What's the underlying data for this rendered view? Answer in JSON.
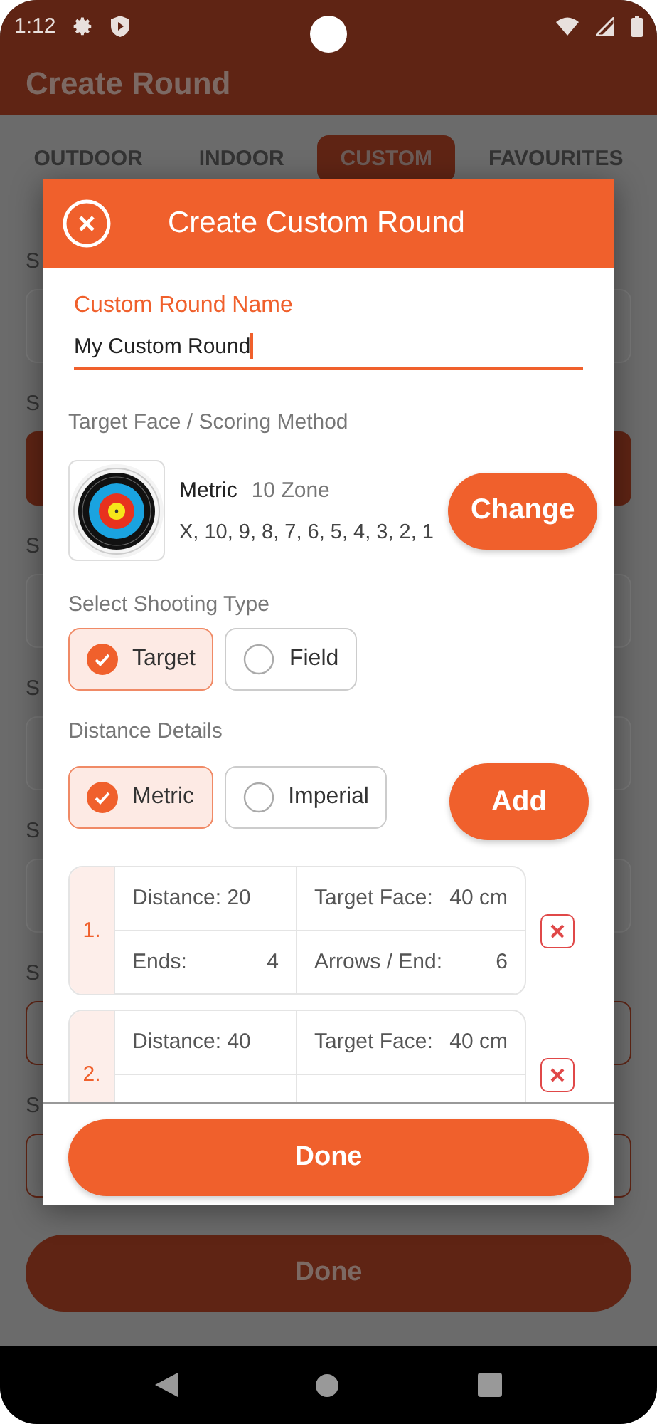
{
  "status_bar": {
    "time": "1:12"
  },
  "app_bar": {
    "title": "Create Round"
  },
  "tabs": [
    {
      "label": "OUTDOOR",
      "selected": false
    },
    {
      "label": "INDOOR",
      "selected": false
    },
    {
      "label": "CUSTOM",
      "selected": true
    },
    {
      "label": "FAVOURITES",
      "selected": false
    }
  ],
  "background_form": [
    {
      "kind": "field",
      "label": "S"
    },
    {
      "kind": "filled",
      "label": "S"
    },
    {
      "kind": "field",
      "label": "S"
    },
    {
      "kind": "field",
      "label": "S"
    },
    {
      "kind": "field",
      "label": "S"
    },
    {
      "kind": "outlined",
      "label": "S"
    },
    {
      "kind": "outlined",
      "label": "S"
    }
  ],
  "background_done": "Done",
  "dialog": {
    "title": "Create Custom Round",
    "name_field": {
      "label": "Custom Round Name",
      "value": "My Custom Round"
    },
    "target_face": {
      "label": "Target Face / Scoring Method",
      "name": "Metric",
      "zones": "10 Zone",
      "scores": "X, 10, 9, 8, 7, 6, 5, 4, 3, 2, 1",
      "button": "Change"
    },
    "shooting_type": {
      "label": "Select Shooting Type",
      "options": [
        {
          "label": "Target",
          "selected": true
        },
        {
          "label": "Field",
          "selected": false
        }
      ]
    },
    "distance_details": {
      "label": "Distance Details",
      "options": [
        {
          "label": "Metric",
          "selected": true
        },
        {
          "label": "Imperial",
          "selected": false
        }
      ],
      "add_button": "Add"
    },
    "distances": [
      {
        "number": "1.",
        "distance_label": "Distance:",
        "distance": "20",
        "face_label": "Target Face:",
        "face": "40 cm",
        "ends_label": "Ends:",
        "ends": "4",
        "arrows_label": "Arrows / End:",
        "arrows": "6"
      },
      {
        "number": "2.",
        "distance_label": "Distance:",
        "distance": "40",
        "face_label": "Target Face:",
        "face": "40 cm"
      }
    ],
    "done_button": "Done"
  }
}
